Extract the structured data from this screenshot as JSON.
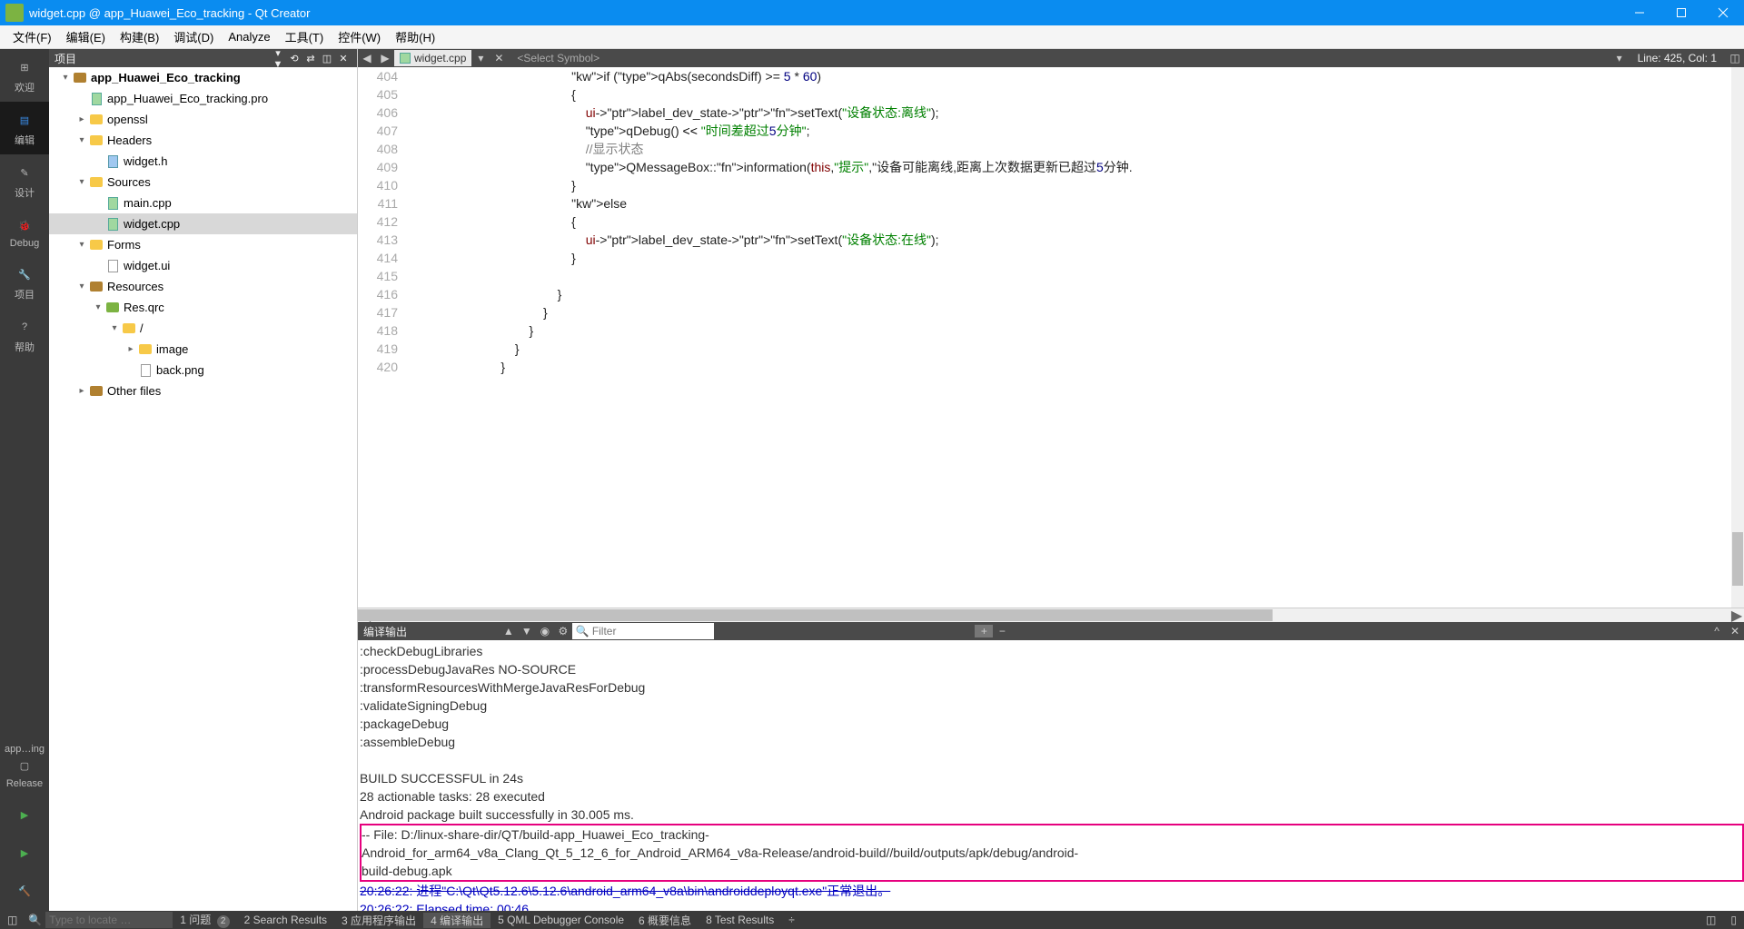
{
  "window": {
    "title": "widget.cpp @ app_Huawei_Eco_tracking - Qt Creator"
  },
  "menu": {
    "file": "文件(F)",
    "edit": "编辑(E)",
    "build": "构建(B)",
    "debug": "调试(D)",
    "analyze": "Analyze",
    "tools": "工具(T)",
    "widgets": "控件(W)",
    "help": "帮助(H)"
  },
  "rail": {
    "welcome": "欢迎",
    "edit": "编辑",
    "design": "设计",
    "debug": "Debug",
    "project": "项目",
    "help": "帮助",
    "kit": "app…ing",
    "release": "Release"
  },
  "sidebar": {
    "title": "项目",
    "tree": [
      {
        "indent": 0,
        "chev": "▾",
        "icon": "folder-brown",
        "label": "app_Huawei_Eco_tracking",
        "bold": true
      },
      {
        "indent": 1,
        "chev": "",
        "icon": "file-cpp",
        "label": "app_Huawei_Eco_tracking.pro"
      },
      {
        "indent": 1,
        "chev": "▸",
        "icon": "folder-yellow",
        "label": "openssl"
      },
      {
        "indent": 1,
        "chev": "▾",
        "icon": "folder-yellow",
        "label": "Headers"
      },
      {
        "indent": 2,
        "chev": "",
        "icon": "file-h",
        "label": "widget.h"
      },
      {
        "indent": 1,
        "chev": "▾",
        "icon": "folder-yellow",
        "label": "Sources"
      },
      {
        "indent": 2,
        "chev": "",
        "icon": "file-cpp",
        "label": "main.cpp"
      },
      {
        "indent": 2,
        "chev": "",
        "icon": "file-cpp",
        "label": "widget.cpp",
        "selected": true
      },
      {
        "indent": 1,
        "chev": "▾",
        "icon": "folder-yellow",
        "label": "Forms"
      },
      {
        "indent": 2,
        "chev": "",
        "icon": "file-icon",
        "label": "widget.ui"
      },
      {
        "indent": 1,
        "chev": "▾",
        "icon": "folder-brown",
        "label": "Resources"
      },
      {
        "indent": 2,
        "chev": "▾",
        "icon": "folder-green",
        "label": "Res.qrc"
      },
      {
        "indent": 3,
        "chev": "▾",
        "icon": "folder-yellow",
        "label": "/"
      },
      {
        "indent": 4,
        "chev": "▸",
        "icon": "folder-yellow",
        "label": "image"
      },
      {
        "indent": 4,
        "chev": "",
        "icon": "file-icon",
        "label": "back.png"
      },
      {
        "indent": 1,
        "chev": "▸",
        "icon": "folder-brown",
        "label": "Other files"
      }
    ]
  },
  "editor": {
    "tab_name": "widget.cpp",
    "symbol_placeholder": "<Select Symbol>",
    "line_col": "Line: 425, Col: 1",
    "gutter_start": 404,
    "lines": [
      "                                            if (qAbs(secondsDiff) >= 5 * 60)",
      "                                            {",
      "                                                ui->label_dev_state->setText(\"设备状态:离线\");",
      "                                                qDebug() << \"时间差超过5分钟\";",
      "                                                //显示状态",
      "                                                QMessageBox::information(this,\"提示\",\"设备可能离线,距离上次数据更新已超过5分钟.",
      "                                            }",
      "                                            else",
      "                                            {",
      "                                                ui->label_dev_state->setText(\"设备状态:在线\");",
      "                                            }",
      "",
      "                                        }",
      "                                    }",
      "                                }",
      "                            }",
      "                        }"
    ]
  },
  "output": {
    "title": "编译输出",
    "filter_placeholder": "Filter",
    "lines": [
      ":checkDebugLibraries",
      ":processDebugJavaRes NO-SOURCE",
      ":transformResourcesWithMergeJavaResForDebug",
      ":validateSigningDebug",
      ":packageDebug",
      ":assembleDebug",
      "",
      "BUILD SUCCESSFUL in 24s",
      "28 actionable tasks: 28 executed",
      "Android package built successfully in 30.005 ms."
    ],
    "highlight": [
      "  -- File: D:/linux-share-dir/QT/build-app_Huawei_Eco_tracking-",
      "Android_for_arm64_v8a_Clang_Qt_5_12_6_for_Android_ARM64_v8a-Release/android-build//build/outputs/apk/debug/android-",
      "build-debug.apk"
    ],
    "finish_line": "20:26:22: 进程\"C:\\Qt\\Qt5.12.6\\5.12.6\\android_arm64_v8a\\bin\\androiddeployqt.exe\"正常退出。",
    "elapsed": "20:26:22: Elapsed time: 00:46."
  },
  "status": {
    "locator_placeholder": "Type to locate …",
    "issues": "1 问题",
    "issues_badge": "2",
    "search": "2 Search Results",
    "appout": "3 应用程序输出",
    "compileout": "4 编译输出",
    "qml": "5 QML Debugger Console",
    "overview": "6 概要信息",
    "tests": "8 Test Results"
  }
}
